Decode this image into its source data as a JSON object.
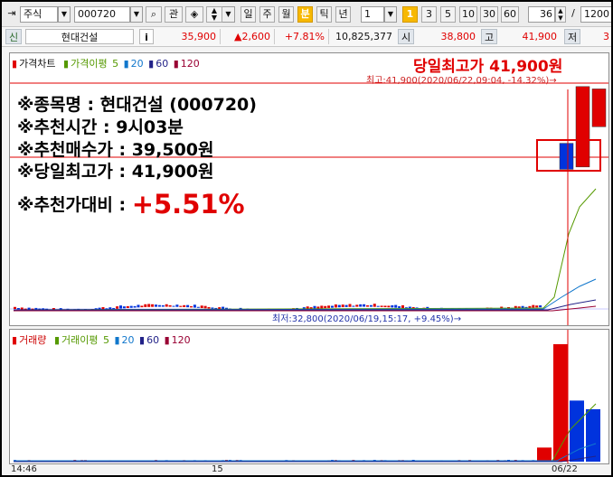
{
  "toolbar": {
    "market": "주식",
    "code": "000720",
    "btn_gwan": "관",
    "periods": [
      "일",
      "주",
      "월",
      "분",
      "틱",
      "년"
    ],
    "active_period": "분",
    "interval_value": "1",
    "badge_1": "1",
    "minutes": [
      "3",
      "5",
      "10",
      "30",
      "60"
    ],
    "count_value": "36",
    "slash": "/",
    "total_value": "1200"
  },
  "quote": {
    "tag": "신",
    "name": "현대건설",
    "info": "i",
    "price": "35,900",
    "change": "▲2,600",
    "change_pct": "+7.81%",
    "volume": "10,825,377",
    "open_label": "시",
    "open_value": "38,800",
    "high_label": "고",
    "high_value": "41,900",
    "low_label": "저",
    "low_value": "3"
  },
  "price_pane": {
    "legend_price": "가격차트",
    "legend_ma": "가격이평",
    "ma_periods": [
      "5",
      "20",
      "60",
      "120"
    ],
    "headline": "당일최고가 41,900원",
    "max_label": "최고:41,900(2020/06/22,09:04, -14.32%)→",
    "min_label": "최저:32,800(2020/06/19,15:17, +9.45%)→",
    "info_lines": [
      "※종목명 : 현대건설 (000720)",
      "※추천시간 : 9시03분",
      "※추천매수가 : 39,500원",
      "※당일최고가 : 41,900원"
    ],
    "compare_label": "※추천가대비 : ",
    "compare_value": "+5.51%"
  },
  "volume_pane": {
    "legend_volume": "거래량",
    "legend_ma": "거래이평",
    "ma_periods": [
      "5",
      "20",
      "60",
      "120"
    ]
  },
  "xaxis": {
    "labels": [
      "14:46",
      "15",
      "06/22"
    ]
  },
  "chart_data": {
    "type": "candlestick",
    "series": [
      {
        "name": "price",
        "values": [
          {
            "x": "06/19 15:17",
            "low": 32800
          },
          {
            "x": "06/22 09:03",
            "open": 39500,
            "close": 38400
          },
          {
            "x": "06/22 09:04",
            "open": 38500,
            "close": 41900,
            "high": 41900
          },
          {
            "x": "06/22 09:05",
            "open": 40200,
            "close": 41800
          }
        ]
      },
      {
        "name": "volume",
        "values": [
          {
            "x": "06/22 09:03",
            "value": 0.12
          },
          {
            "x": "06/22 09:04",
            "value": 1.0
          },
          {
            "x": "06/22 09:05",
            "value": 0.52
          }
        ]
      }
    ],
    "colors": {
      "up": "#e00000",
      "down": "#0033dd",
      "ma5": "#559900",
      "ma20": "#1177cc",
      "ma60": "#222288",
      "ma120": "#990033"
    }
  }
}
